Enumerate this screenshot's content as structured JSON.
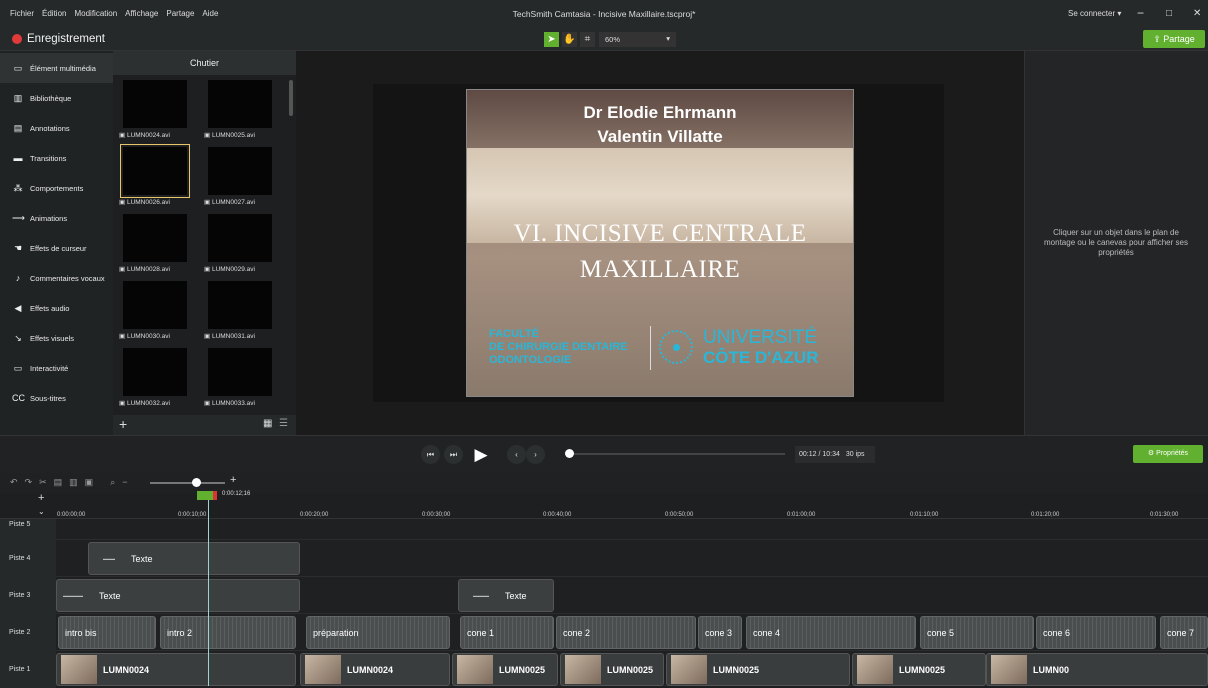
{
  "menu": [
    "Fichier",
    "Édition",
    "Modification",
    "Affichage",
    "Partage",
    "Aide"
  ],
  "window_title": "TechSmith Camtasia - Incisive Maxillaire.tscproj*",
  "connect": "Se connecter ▾",
  "win_controls": [
    "−",
    "□",
    "✕"
  ],
  "record_label": "Enregistrement",
  "tools": [
    "arrow-icon",
    "hand-icon",
    "crop-icon"
  ],
  "zoom": "60%",
  "share_label": "Partage",
  "sidebar": [
    {
      "label": "Élément multimédia",
      "icon": "film-icon"
    },
    {
      "label": "Bibliothèque",
      "icon": "library-icon"
    },
    {
      "label": "Annotations",
      "icon": "annotation-icon"
    },
    {
      "label": "Transitions",
      "icon": "transition-icon"
    },
    {
      "label": "Comportements",
      "icon": "behavior-icon"
    },
    {
      "label": "Animations",
      "icon": "animation-icon"
    },
    {
      "label": "Effets de curseur",
      "icon": "cursor-icon"
    },
    {
      "label": "Commentaires vocaux",
      "icon": "mic-icon"
    },
    {
      "label": "Effets audio",
      "icon": "speaker-icon"
    },
    {
      "label": "Effets visuels",
      "icon": "wand-icon"
    },
    {
      "label": "Interactivité",
      "icon": "interactive-icon"
    },
    {
      "label": "Sous-titres",
      "icon": "captions-icon"
    }
  ],
  "bin_title": "Chutier",
  "bin_clips": [
    "LUMN0024.avi",
    "LUMN0025.avi",
    "LUMN0026.avi",
    "LUMN0027.avi",
    "LUMN0028.avi",
    "LUMN0029.avi",
    "LUMN0030.avi",
    "LUMN0031.avi",
    "LUMN0032.avi",
    "LUMN0033.avi"
  ],
  "slide": {
    "line1": "Dr Elodie Ehrmann",
    "line2": "Valentin Villatte",
    "title1": "VI. INCISIVE CENTRALE",
    "title2": "MAXILLAIRE",
    "fac1": "FACULTÉ",
    "fac2": "DE CHIRURGIE DENTAIRE",
    "fac3": "ODONTOLOGIE",
    "uni1": "UNIVERSITÉ",
    "uni2": "CÔTE D'AZUR"
  },
  "props_message": "Cliquer sur un objet dans le plan de montage ou le canevas pour afficher ses propriétés",
  "player": {
    "time": "00:12 / 10:34",
    "fps": "30 ips",
    "progress": 0.02
  },
  "props_button": "Propriétés",
  "playhead_time": "0:00:12;16",
  "ruler": [
    "0:00:00;00",
    "0:00:10;00",
    "0:00:20;00",
    "0:00:30;00",
    "0:00:40;00",
    "0:00:50;00",
    "0:01:00;00",
    "0:01:10;00",
    "0:01:20;00",
    "0:01:30;00"
  ],
  "tracks": [
    {
      "label": "Piste 4",
      "clips": [
        {
          "label": "Texte"
        }
      ]
    },
    {
      "label": "Piste 3",
      "clips": [
        {
          "label": "Texte"
        },
        {
          "label": "Texte"
        }
      ]
    },
    {
      "label": "Piste 2",
      "clips": [
        {
          "label": "intro bis"
        },
        {
          "label": "intro 2"
        },
        {
          "label": "préparation"
        },
        {
          "label": "cone 1"
        },
        {
          "label": "cone 2"
        },
        {
          "label": "cone 3"
        },
        {
          "label": "cone 4"
        },
        {
          "label": "cone 5"
        },
        {
          "label": "cone 6"
        },
        {
          "label": "cone 7"
        }
      ]
    },
    {
      "label": "Piste 1",
      "clips": [
        {
          "label": "LUMN0024"
        },
        {
          "label": "LUMN0024"
        },
        {
          "label": "LUMN0025"
        },
        {
          "label": "LUMN0025"
        },
        {
          "label": "LUMN0025"
        },
        {
          "label": "LUMN0025"
        },
        {
          "label": "LUMN00"
        }
      ]
    }
  ],
  "track5_label": "Piste 5"
}
